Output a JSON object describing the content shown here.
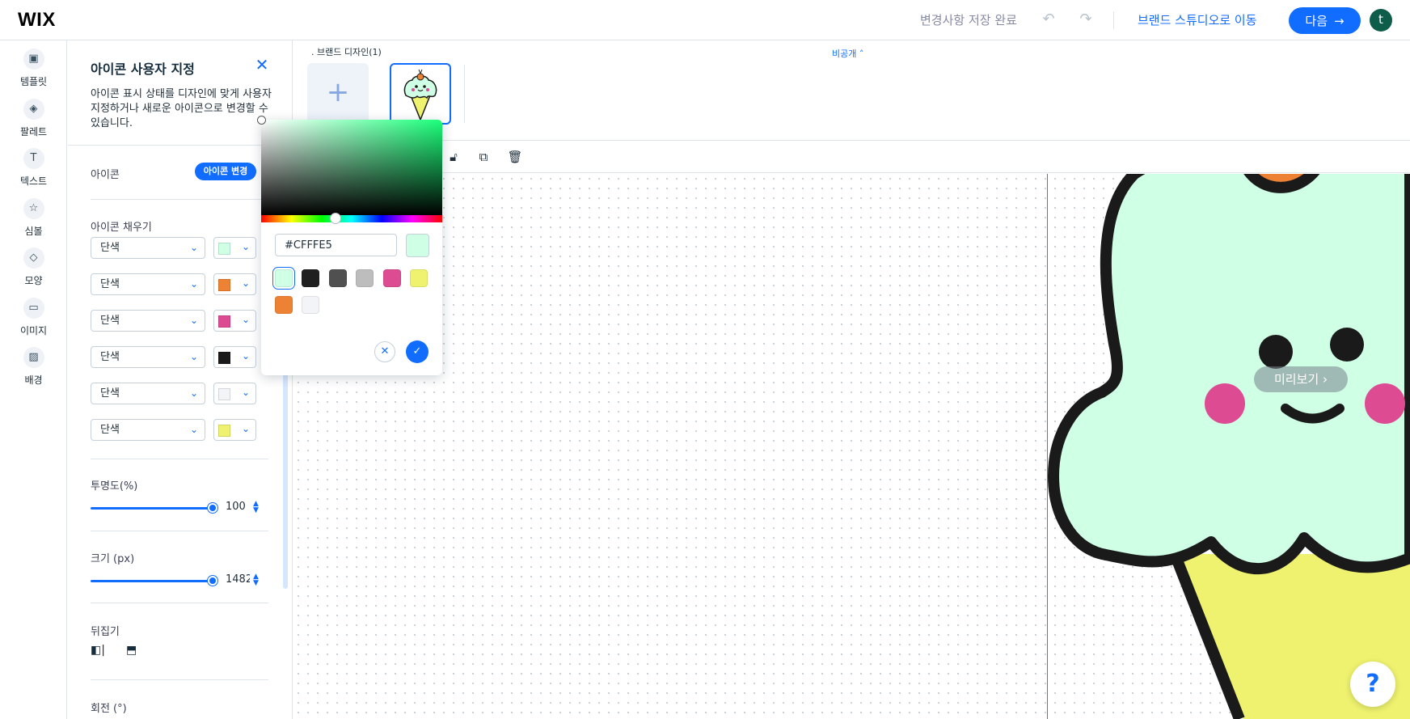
{
  "topbar": {
    "logo": "WIX",
    "save_status": "변경사항 저장 완료",
    "brand_studio_link": "브랜드 스튜디오로 이동",
    "next_label": "다음",
    "avatar_initial": "t"
  },
  "rail": {
    "items": [
      {
        "label": "템플릿",
        "icon": "template-icon"
      },
      {
        "label": "팔레트",
        "icon": "palette-icon"
      },
      {
        "label": "텍스트",
        "icon": "text-icon"
      },
      {
        "label": "심볼",
        "icon": "star-icon"
      },
      {
        "label": "모양",
        "icon": "shapes-icon"
      },
      {
        "label": "이미지",
        "icon": "image-icon"
      },
      {
        "label": "배경",
        "icon": "background-icon"
      }
    ]
  },
  "panel": {
    "title": "아이콘 사용자 지정",
    "description": "아이콘 표시 상태를 디자인에 맞게 사용자 지정하거나 새로운 아이콘으로 변경할 수 있습니다.",
    "icon_label": "아이콘",
    "change_icon_label": "아이콘 변경",
    "fill_label": "아이콘 채우기",
    "fills": [
      {
        "type": "단색",
        "color": "#CFFFE5"
      },
      {
        "type": "단색",
        "color": "#EE8234"
      },
      {
        "type": "단색",
        "color": "#DD4B93"
      },
      {
        "type": "단색",
        "color": "#1A1A1A"
      },
      {
        "type": "단색",
        "color": "#F2F4F8"
      },
      {
        "type": "단색",
        "color": "#EEF26E"
      }
    ],
    "opacity_label": "투명도(%)",
    "opacity_value": "100",
    "size_label": "크기 (px)",
    "size_value": "1482",
    "flip_label": "뒤집기",
    "rotate_label": "회전 (°)"
  },
  "canvas": {
    "brand_designs_label": ". 브랜드 디자인(1)",
    "private_label": "비공개",
    "preview_label": "미리보기",
    "help_label": "?"
  },
  "picker": {
    "hex_value": "#CFFFE5",
    "hue_position": 0.41,
    "presets": [
      "#CFFFE5",
      "#1F1F1F",
      "#505050",
      "#BDBDBD",
      "#DD4B93",
      "#EEF26E",
      "#EE8234",
      "#F2F4F8"
    ]
  }
}
